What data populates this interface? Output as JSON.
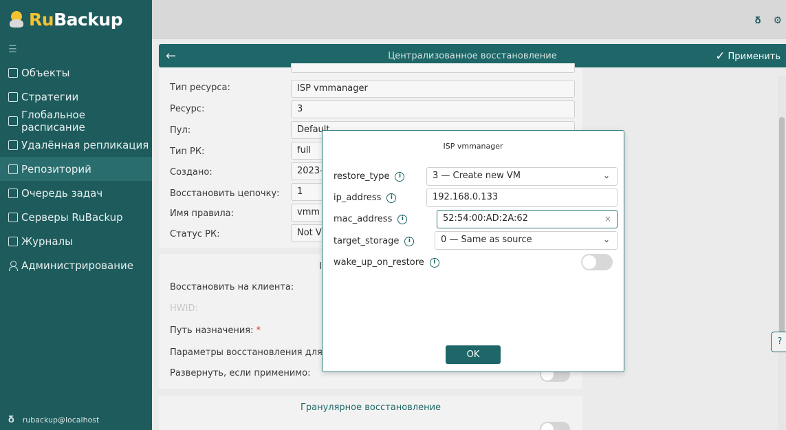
{
  "app": {
    "logo_ru": "Ru",
    "logo_backup": "Backup"
  },
  "sidebar": {
    "collapse_icon": "collapse-icon",
    "items": [
      {
        "label": "Объекты",
        "icon": "monitor-icon"
      },
      {
        "label": "Стратегии",
        "icon": "document-icon"
      },
      {
        "label": "Глобальное расписание",
        "icon": "list-icon"
      },
      {
        "label": "Удалённая репликация",
        "icon": "replication-icon"
      },
      {
        "label": "Репозиторий",
        "icon": "repository-icon",
        "active": true
      },
      {
        "label": "Очередь задач",
        "icon": "queue-icon"
      },
      {
        "label": "Серверы RuBackup",
        "icon": "server-icon"
      },
      {
        "label": "Журналы",
        "icon": "log-icon"
      },
      {
        "label": "Администрирование",
        "icon": "admin-icon"
      }
    ],
    "user": "rubackup@localhost"
  },
  "header": {
    "title": "Централизованное восстановление",
    "apply_label": "Применить"
  },
  "details": {
    "rows": [
      {
        "label": "Тип ресурса:",
        "value": "ISP vmmanager"
      },
      {
        "label": "Ресурс:",
        "value": "3"
      },
      {
        "label": "Пул:",
        "value": "Default"
      },
      {
        "label": "Тип РК:",
        "value": "full"
      },
      {
        "label": "Создано:",
        "value": "2023-"
      },
      {
        "label": "Восстановить цепочку:",
        "value": "1"
      },
      {
        "label": "Имя правила:",
        "value": "vmm"
      },
      {
        "label": "Статус РК:",
        "value": "Not V"
      }
    ]
  },
  "restore": {
    "client_label": "Восстановить на клиента:",
    "hwid_label": "HWID:",
    "path_label": "Путь назначения:",
    "path_required": "*",
    "params_label": "Параметры восстановления для м",
    "deploy_label": "Развернуть, если применимо:",
    "section_letter": "I"
  },
  "granular": {
    "title": "Гранулярное восстановление"
  },
  "modal": {
    "title": "ISP vmmanager",
    "fields": {
      "restore_type": {
        "label": "restore_type",
        "value": "3 — Create new VM"
      },
      "ip_address": {
        "label": "ip_address",
        "value": "192.168.0.133"
      },
      "mac_address": {
        "label": "mac_address",
        "value": "52:54:00:AD:2A:62"
      },
      "target_storage": {
        "label": "target_storage",
        "value": "0 — Same as source"
      },
      "wake_up_on_restore": {
        "label": "wake_up_on_restore",
        "enabled": false
      }
    },
    "info_glyph": "i",
    "ok_label": "OK"
  },
  "help": {
    "label": "?"
  },
  "colors": {
    "sidebar": "#1e5b5c",
    "accent": "#1e6667",
    "logo_yellow": "#f2c230"
  }
}
